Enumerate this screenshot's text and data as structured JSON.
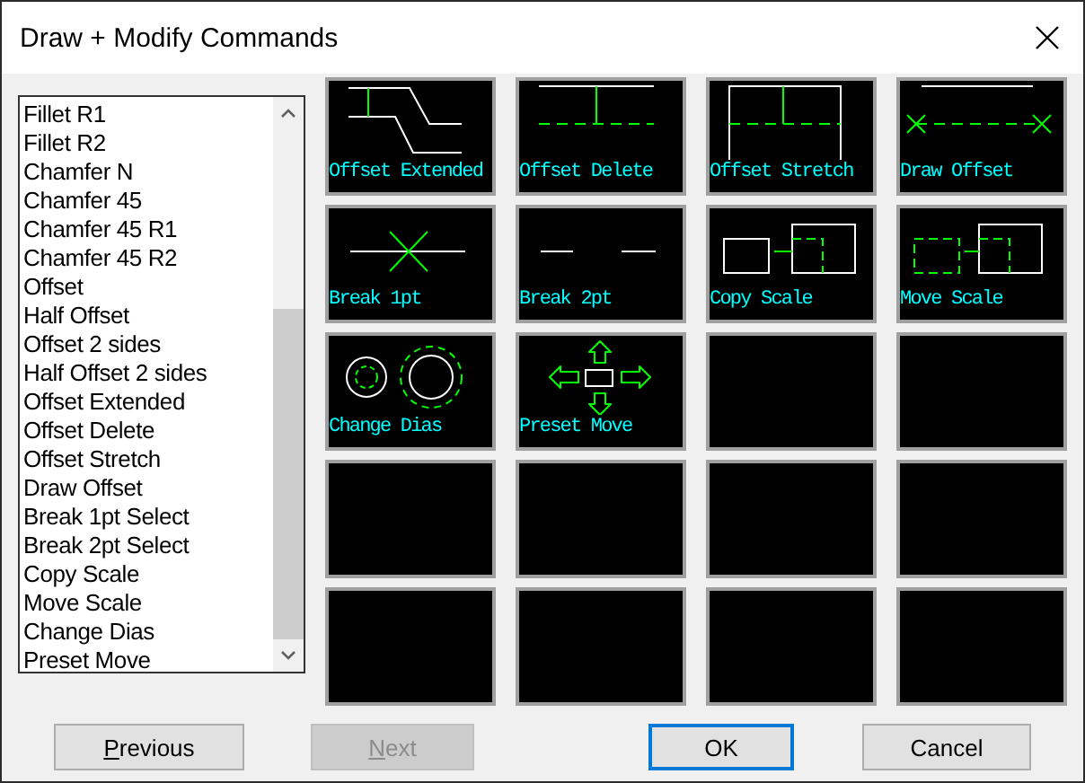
{
  "window": {
    "title": "Draw + Modify Commands"
  },
  "command_list": [
    "Fillet R1",
    "Fillet R2",
    "Chamfer N",
    "Chamfer 45",
    "Chamfer 45 R1",
    "Chamfer 45 R2",
    "Offset",
    "Half Offset",
    "Offset 2 sides",
    "Half Offset 2 sides",
    "Offset Extended",
    "Offset Delete",
    "Offset Stretch",
    "Draw Offset",
    "Break 1pt Select",
    "Break 2pt Select",
    "Copy Scale",
    "Move Scale",
    "Change Dias",
    "Preset Move"
  ],
  "tiles": [
    {
      "kind": "offset-extended",
      "label": "Offset Extended"
    },
    {
      "kind": "offset-delete",
      "label": "Offset Delete"
    },
    {
      "kind": "offset-stretch",
      "label": "Offset Stretch"
    },
    {
      "kind": "draw-offset",
      "label": "Draw Offset"
    },
    {
      "kind": "break-1pt",
      "label": "Break 1pt"
    },
    {
      "kind": "break-2pt",
      "label": "Break 2pt"
    },
    {
      "kind": "copy-scale",
      "label": "Copy Scale"
    },
    {
      "kind": "move-scale",
      "label": "Move Scale"
    },
    {
      "kind": "change-dias",
      "label": "Change Dias"
    },
    {
      "kind": "preset-move",
      "label": "Preset Move"
    },
    {
      "kind": "empty"
    },
    {
      "kind": "empty"
    },
    {
      "kind": "empty"
    },
    {
      "kind": "empty"
    },
    {
      "kind": "empty"
    },
    {
      "kind": "empty"
    },
    {
      "kind": "empty"
    },
    {
      "kind": "empty"
    },
    {
      "kind": "empty"
    },
    {
      "kind": "empty"
    }
  ],
  "buttons": [
    {
      "mnemonic": "P",
      "rest": "revious",
      "disabled": false,
      "default": false
    },
    {
      "mnemonic": "N",
      "rest": "ext",
      "disabled": true,
      "default": false
    },
    {
      "label": "OK",
      "disabled": false,
      "default": true
    },
    {
      "label": "Cancel",
      "disabled": false,
      "default": false
    }
  ]
}
